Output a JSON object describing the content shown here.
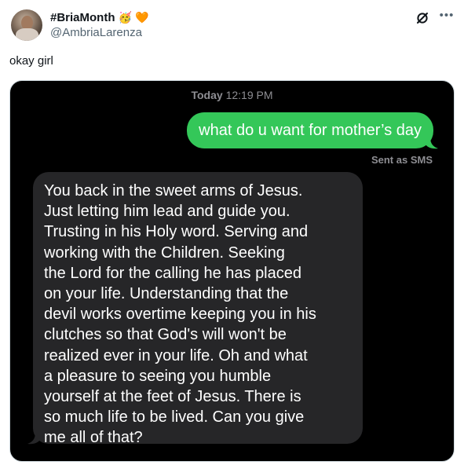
{
  "author": {
    "display_name": "#BriaMonth",
    "emojis": [
      "🥳",
      "🧡"
    ],
    "handle": "@AmbriaLarenza",
    "avatar_icon": "user-avatar"
  },
  "header_icons": [
    "grok-icon",
    "more-icon"
  ],
  "tweet_text": "okay girl",
  "conversation": {
    "timestamp_day": "Today",
    "timestamp_time": "12:19 PM",
    "sent_message": "what do u want for mother’s day",
    "sent_status": "Sent as SMS",
    "received_lines": [
      "You back in the sweet arms of Jesus.",
      "Just letting him lead and guide you.",
      "Trusting in his Holy word.  Serving and",
      "working with the Children.  Seeking",
      "the Lord for the calling he has placed",
      "on your life.  Understanding that the",
      "devil works overtime keeping you in his",
      "clutches so that God's will won't be",
      "realized ever in your life.  Oh and what",
      "a pleasure to seeing you humble",
      "yourself at the feet of Jesus.  There is",
      "so much life to be lived.  Can you give",
      "me all of that?"
    ],
    "colors": {
      "sent_bubble": "#34c759",
      "received_bubble": "#262628",
      "background": "#000000",
      "meta_text": "#8e8e93"
    }
  }
}
